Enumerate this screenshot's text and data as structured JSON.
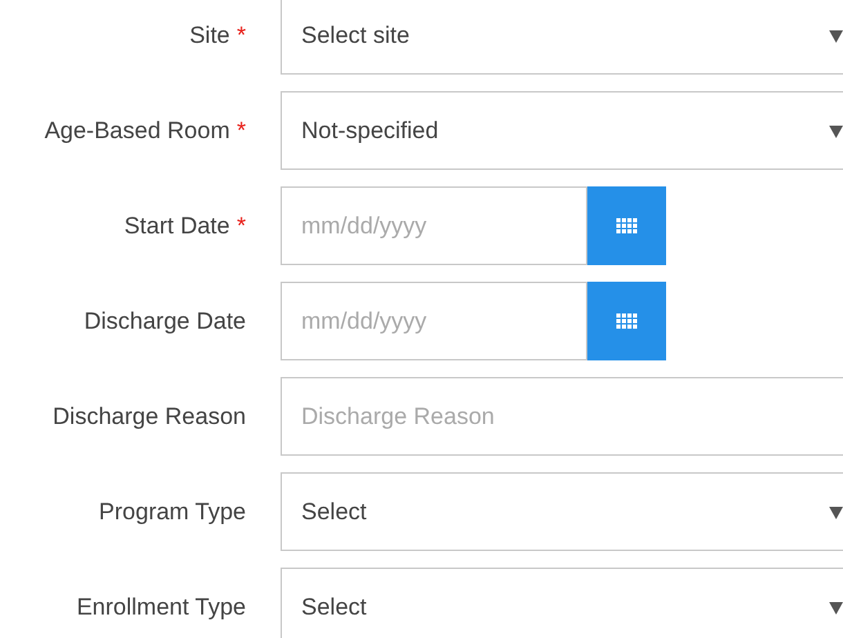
{
  "fields": [
    {
      "kind": "select",
      "label": "Site",
      "required_mark": "*",
      "value": "Select site"
    },
    {
      "kind": "select",
      "label": "Age-Based Room",
      "required_mark": "*",
      "value": "Not-specified"
    },
    {
      "kind": "date",
      "label": "Start Date",
      "required_mark": "*",
      "placeholder": "mm/dd/yyyy"
    },
    {
      "kind": "date",
      "label": "Discharge Date",
      "placeholder": "mm/dd/yyyy"
    },
    {
      "kind": "text",
      "label": "Discharge Reason",
      "placeholder": "Discharge Reason"
    },
    {
      "kind": "select",
      "label": "Program Type",
      "value": "Select"
    },
    {
      "kind": "select",
      "label": "Enrollment Type",
      "value": "Select"
    }
  ]
}
